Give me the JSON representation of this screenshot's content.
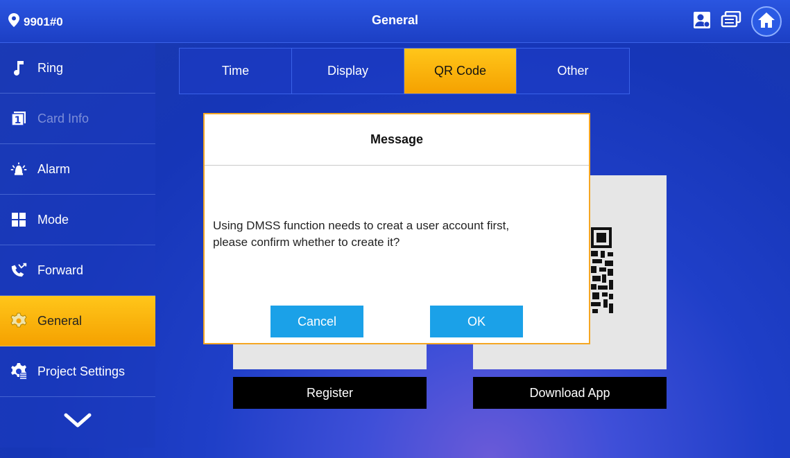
{
  "header": {
    "location": "9901#0",
    "title": "General",
    "icons": [
      "location-pin-icon",
      "contacts-icon",
      "messages-icon",
      "home-icon"
    ]
  },
  "sidebar": {
    "items": [
      {
        "label": "Ring",
        "icon": "music-note-icon",
        "state": "normal"
      },
      {
        "label": "Card Info",
        "icon": "card-icon",
        "state": "disabled"
      },
      {
        "label": "Alarm",
        "icon": "alarm-icon",
        "state": "normal"
      },
      {
        "label": "Mode",
        "icon": "mode-icon",
        "state": "normal"
      },
      {
        "label": "Forward",
        "icon": "forward-call-icon",
        "state": "normal"
      },
      {
        "label": "General",
        "icon": "gear-icon",
        "state": "active"
      },
      {
        "label": "Project Settings",
        "icon": "project-settings-icon",
        "state": "normal"
      }
    ],
    "more_icon": "chevron-down-icon"
  },
  "tabs": [
    {
      "label": "Time",
      "active": false
    },
    {
      "label": "Display",
      "active": false
    },
    {
      "label": "QR Code",
      "active": true
    },
    {
      "label": "Other",
      "active": false
    }
  ],
  "qr_section": {
    "register_label": "Register",
    "download_label": "Download App"
  },
  "dialog": {
    "title": "Message",
    "message_line1": "Using DMSS function needs to creat a user account first,",
    "message_line2": "please confirm whether to create it?",
    "cancel_label": "Cancel",
    "ok_label": "OK"
  },
  "colors": {
    "accent": "#f5a623",
    "dialog_button": "#1ba1e8",
    "background": "#1f3fc8"
  }
}
